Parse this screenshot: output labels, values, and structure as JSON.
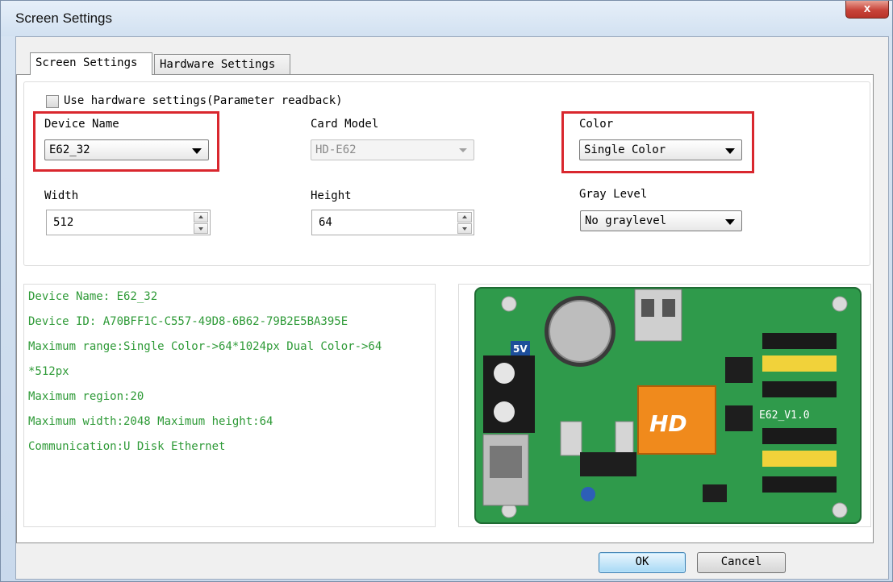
{
  "window": {
    "title": "Screen Settings",
    "close_glyph": "x"
  },
  "tabs": [
    {
      "label": "Screen Settings",
      "active": true
    },
    {
      "label": "Hardware Settings",
      "active": false
    }
  ],
  "screen": {
    "use_hw_label": "Use hardware settings(Parameter readback)",
    "use_hw_checked": false,
    "device_name": {
      "label": "Device Name",
      "value": "E62_32"
    },
    "card_model": {
      "label": "Card Model",
      "value": "HD-E62",
      "disabled": true
    },
    "color": {
      "label": "Color",
      "value": "Single Color"
    },
    "width": {
      "label": "Width",
      "value": "512"
    },
    "height": {
      "label": "Height",
      "value": "64"
    },
    "gray_level": {
      "label": "Gray Level",
      "value": "No graylevel"
    }
  },
  "info": {
    "lines": [
      "Device Name: E62_32",
      "Device ID:  A70BFF1C-C557-49D8-6B62-79B2E5BA395E",
      "Maximum range:Single Color->64*1024px  Dual Color->64",
      "*512px",
      "Maximum region:20",
      "Maximum width:2048 Maximum height:64",
      "Communication:U Disk  Ethernet"
    ]
  },
  "board_image": {
    "silkscreen_5v": "5V",
    "silkscreen_model": "E62_V1.0",
    "logo_text": "HD",
    "board_color": "#2f9a4b"
  },
  "footer": {
    "ok_label": "OK",
    "cancel_label": "Cancel"
  },
  "colors": {
    "highlight": "#d9272e",
    "info_text": "#2e9a37"
  }
}
